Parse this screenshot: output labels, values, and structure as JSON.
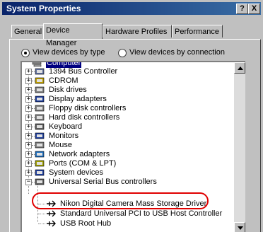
{
  "window": {
    "title": "System Properties",
    "help_btn": "?",
    "close_btn": "X"
  },
  "tabs": [
    {
      "label": "General"
    },
    {
      "label": "Device Manager"
    },
    {
      "label": "Hardware Profiles"
    },
    {
      "label": "Performance"
    }
  ],
  "view": {
    "by_type": "View devices by type",
    "by_connection": "View devices by connection",
    "selected": "type"
  },
  "tree": {
    "root": "Computer",
    "categories": [
      "1394 Bus Controller",
      "CDROM",
      "Disk drives",
      "Display adapters",
      "Floppy disk controllers",
      "Hard disk controllers",
      "Keyboard",
      "Monitors",
      "Mouse",
      "Network adapters",
      "Ports (COM & LPT)",
      "System devices",
      "Universal Serial Bus controllers"
    ],
    "usb_children": [
      "Nikon Digital Camera Mass Storage Driver",
      "Standard Universal PCI to USB Host Controller",
      "USB Root Hub"
    ]
  },
  "colors": {
    "titlebar": "#0a246a",
    "highlight_circle": "#e00000",
    "face": "#c0c0c0"
  }
}
